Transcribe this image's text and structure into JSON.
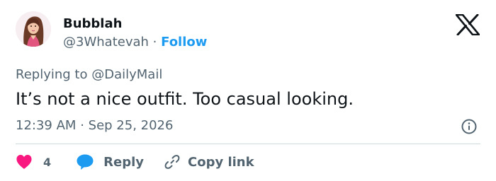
{
  "author": {
    "name": "Bubblah",
    "handle": "@3Whatevah",
    "separator": "·",
    "follow_label": "Follow"
  },
  "reply_context": {
    "prefix": "Replying to",
    "mention": "@DailyMail"
  },
  "tweet": {
    "text": "It’s not a nice outfit. Too casual looking.",
    "time": "12:39 AM",
    "separator": "·",
    "date": "Sep 25, 2026"
  },
  "actions": {
    "like_count": "4",
    "reply_label": "Reply",
    "copy_link_label": "Copy link"
  },
  "icons": {
    "brand": "x-logo-icon",
    "info": "info-icon",
    "like": "heart-icon",
    "reply": "speech-bubble-icon",
    "copy": "link-icon"
  },
  "colors": {
    "accent": "#1d9bf0",
    "like": "#f91880",
    "text": "#0f1419",
    "muted": "#536471",
    "divider": "#cfd9de"
  }
}
